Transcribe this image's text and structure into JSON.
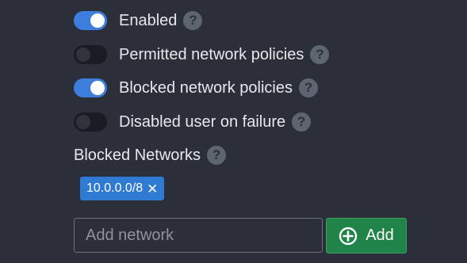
{
  "toggles": [
    {
      "label": "Enabled",
      "on": true
    },
    {
      "label": "Permitted network policies",
      "on": false
    },
    {
      "label": "Blocked network policies",
      "on": true
    },
    {
      "label": "Disabled user on failure",
      "on": false
    }
  ],
  "help_glyph": "?",
  "blocked_networks": {
    "label": "Blocked Networks",
    "tags": [
      {
        "value": "10.0.0.0/8",
        "remove_glyph": "✕"
      }
    ],
    "input": {
      "placeholder": "Add network",
      "value": ""
    },
    "add_button": {
      "label": "Add",
      "icon": "plus-circle-icon"
    }
  },
  "colors": {
    "background": "#2b2f3a",
    "switch_on": "#3d7ddb",
    "switch_off": "#191c22",
    "tag": "#2f7ad3",
    "add_button": "#208347",
    "help_badge": "#5f6570"
  }
}
